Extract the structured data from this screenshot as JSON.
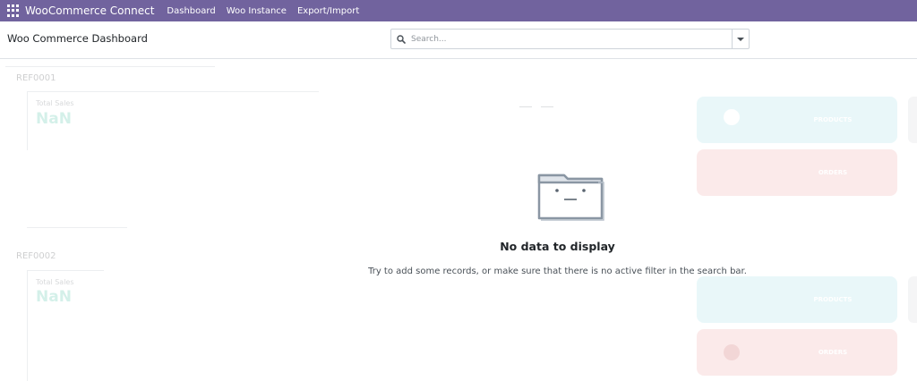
{
  "navbar": {
    "brand": "WooCommerce Connect",
    "menu": [
      "Dashboard",
      "Woo Instance",
      "Export/Import"
    ]
  },
  "control_panel": {
    "title": "Woo Commerce Dashboard",
    "search_placeholder": "Search..."
  },
  "dashboard": {
    "instances": [
      {
        "ref": "REF0001",
        "total_sales_label": "Total Sales",
        "total_sales_value": "NaN",
        "products_label": "PRODUCTS",
        "orders_label": "ORDERS"
      },
      {
        "ref": "REF0002",
        "total_sales_label": "Total Sales",
        "total_sales_value": "NaN",
        "products_label": "PRODUCTS",
        "orders_label": "ORDERS"
      }
    ]
  },
  "empty_state": {
    "title": "No data to display",
    "help": "Try to add some records, or make sure that there is no active filter in the search bar."
  },
  "colors": {
    "navbar": "#71639e",
    "products_tile": "#9ddfe6",
    "orders_tile": "#f1a3a3",
    "nan_value": "#3fbf9f"
  },
  "icons": {
    "apps": "apps-grid-icon",
    "search": "search-icon",
    "toggle": "caret-down-icon",
    "empty": "empty-folder-icon",
    "globe": "globe-icon"
  }
}
